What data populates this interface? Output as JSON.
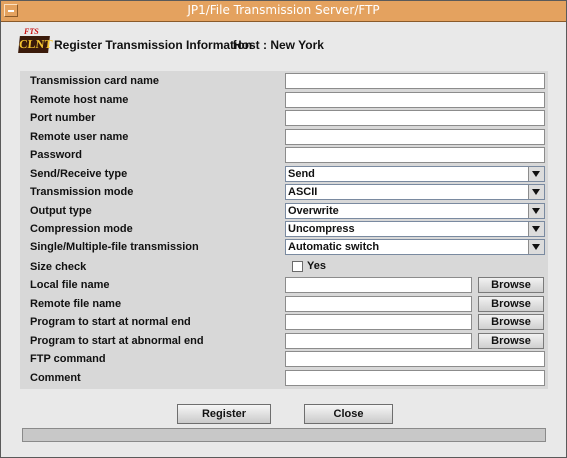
{
  "window": {
    "title": "JP1/File Transmission Server/FTP"
  },
  "header": {
    "logo_top": "FTS",
    "logo_bottom": "CLNT",
    "title": "Register Transmission Information",
    "host": "Host : New York"
  },
  "fields": {
    "card_name": {
      "label": "Transmission card name",
      "value": ""
    },
    "remote_host": {
      "label": "Remote host name",
      "value": ""
    },
    "port": {
      "label": "Port number",
      "value": ""
    },
    "remote_user": {
      "label": "Remote user name",
      "value": ""
    },
    "password": {
      "label": "Password",
      "value": ""
    },
    "send_receive": {
      "label": "Send/Receive type",
      "value": "Send"
    },
    "trans_mode": {
      "label": "Transmission mode",
      "value": "ASCII"
    },
    "output_type": {
      "label": "Output type",
      "value": "Overwrite"
    },
    "compression": {
      "label": "Compression mode",
      "value": "Uncompress"
    },
    "single_multi": {
      "label": "Single/Multiple-file transmission",
      "value": "Automatic switch"
    },
    "size_check": {
      "label": "Size check",
      "option": "Yes",
      "checked": false
    },
    "local_file": {
      "label": "Local file name",
      "value": "",
      "button": "Browse"
    },
    "remote_file": {
      "label": "Remote file name",
      "value": "",
      "button": "Browse"
    },
    "prog_normal": {
      "label": "Program to start at normal end",
      "value": "",
      "button": "Browse"
    },
    "prog_abnormal": {
      "label": "Program to start at abnormal end",
      "value": "",
      "button": "Browse"
    },
    "ftp_command": {
      "label": "FTP command",
      "value": ""
    },
    "comment": {
      "label": "Comment",
      "value": ""
    }
  },
  "buttons": {
    "register": "Register",
    "close": "Close"
  }
}
